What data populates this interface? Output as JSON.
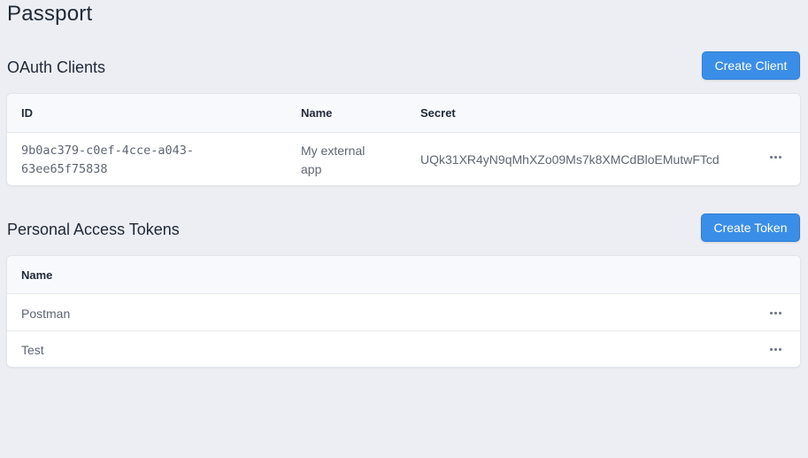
{
  "page": {
    "title": "Passport"
  },
  "oauth_clients": {
    "title": "OAuth Clients",
    "create_button": "Create Client",
    "columns": [
      "ID",
      "Name",
      "Secret"
    ],
    "rows": [
      {
        "id_line1": "9b0ac379-c0ef-4cce-a043-",
        "id_line2": "63ee65f75838",
        "name_line1": "My external",
        "name_line2": "app",
        "secret": "UQk31XR4yN9qMhXZo09Ms7k8XMCdBloEMutwFTcd",
        "actions_icon": "more-horizontal-icon"
      }
    ]
  },
  "personal_access_tokens": {
    "title": "Personal Access Tokens",
    "create_button": "Create Token",
    "columns": [
      "Name"
    ],
    "rows": [
      {
        "name": "Postman",
        "actions_icon": "more-horizontal-icon"
      },
      {
        "name": "Test",
        "actions_icon": "more-horizontal-icon"
      }
    ]
  },
  "colors": {
    "background": "#eceef3",
    "accent": "#3b8ee8",
    "card": "#ffffff",
    "header_bg": "#f8f9fc"
  }
}
